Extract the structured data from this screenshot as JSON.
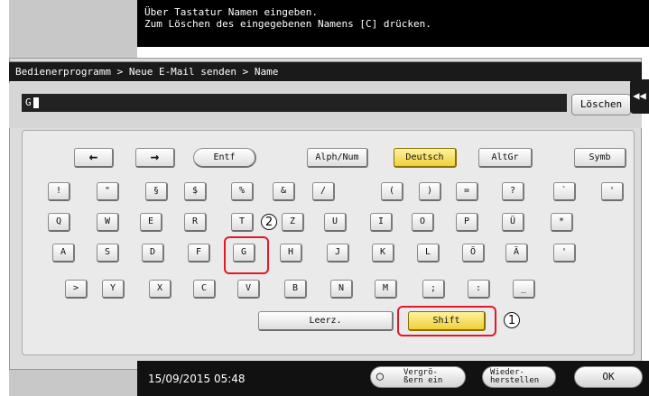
{
  "message": {
    "line1": "Über Tastatur Namen eingeben.",
    "line2": "Zum Löschen des eingegebenen Namens [C] drücken."
  },
  "breadcrumb": "Bedienerprogramm > Neue E-Mail senden > Name",
  "input": {
    "value": "G"
  },
  "delete_label": "Löschen",
  "collapse_icon": "double-chevron-left-icon",
  "keyboard": {
    "func_row": {
      "back_arrow": "←",
      "forward_arrow": "→",
      "delete_key": "Entf",
      "alph_num": "Alph/Num",
      "deutsch": "Deutsch",
      "altgr": "AltGr",
      "symb": "Symb"
    },
    "row1": [
      "!",
      "\"",
      "§",
      "$",
      "%",
      "&",
      "/",
      "(",
      ")",
      "=",
      "?",
      "`",
      "'"
    ],
    "row2": [
      "Q",
      "W",
      "E",
      "R",
      "T",
      "Z",
      "U",
      "I",
      "O",
      "P",
      "Ü",
      "*"
    ],
    "row3": [
      "A",
      "S",
      "D",
      "F",
      "G",
      "H",
      "J",
      "K",
      "L",
      "Ö",
      "Ä",
      "'"
    ],
    "row4": [
      ">",
      "Y",
      "X",
      "C",
      "V",
      "B",
      "N",
      "M",
      ";",
      ":",
      "_"
    ],
    "space_label": "Leerz.",
    "shift_label": "Shift"
  },
  "callouts": {
    "one": "1",
    "two": "2"
  },
  "highlight_color": "#e01a2a",
  "active_key_color": "#f0cf3a",
  "bottom": {
    "datetime": "15/09/2015  05:48",
    "zoom_line1": "Vergrö-",
    "zoom_line2": "ßern ein",
    "restore_line1": "Wieder-",
    "restore_line2": "herstellen",
    "ok_label": "OK"
  }
}
